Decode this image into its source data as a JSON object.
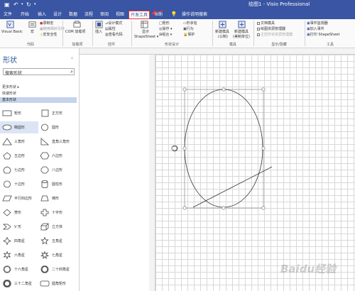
{
  "titlebar": {
    "doc_title": "绘图1 - Visio Professional"
  },
  "tabs": [
    "文件",
    "开始",
    "插入",
    "设计",
    "数据",
    "流程",
    "审阅",
    "视图",
    "开发工具",
    "帮助",
    "操作说明搜索"
  ],
  "ribbon": {
    "code": {
      "vb": "Visual Basic",
      "macro": "宏",
      "rec": "录制宏",
      "rel": "使用相对引用",
      "sec": "宏安全性",
      "label": "代码"
    },
    "addins": {
      "com": "COM 加载项",
      "label": "加载项"
    },
    "controls": {
      "insert": "插入",
      "design": "设计模式",
      "props": "属性",
      "code": "查看代码",
      "label": "控件"
    },
    "shape_design": {
      "show": "显示",
      "shapesheet": "ShapeSheet ▾",
      "rect": "矩形",
      "line": "线条",
      "oper": "操作 ▾",
      "combine": "组合 ▾",
      "name": "形状名",
      "behav": "行为",
      "prot": "保护",
      "label": "形状设计"
    },
    "template": {
      "new_stencil": "新建模具",
      "new_stencil_sub": "(公制)",
      "new_stencil2": "新建模具",
      "new_stencil2_sub": "(美制单位)",
      "label": "模具"
    },
    "show_hide": {
      "doc_stencil": "文档模具",
      "drawing_explorer": "绘图资源管理器",
      "master_explorer": "主控形状资源管理器",
      "label": "显示/隐藏"
    },
    "tools": {
      "event": "事件监视器",
      "addon": "加入事件",
      "print": "打印 ShapeSheet",
      "label": "工具"
    }
  },
  "sidebar": {
    "title": "形状",
    "search_placeholder": "搜索形状",
    "more": "更多形状",
    "quick": "快速形状",
    "basic": "基本形状",
    "shapes": [
      [
        "矩形",
        "正方形"
      ],
      [
        "椭圆形",
        "圆形"
      ],
      [
        "三角形",
        "直角三角形"
      ],
      [
        "五边形",
        "六边形"
      ],
      [
        "七边形",
        "八边形"
      ],
      [
        "十边形",
        "圆柱形"
      ],
      [
        "平行四边形",
        "梯形"
      ],
      [
        "菱形",
        "十字形"
      ],
      [
        "V 形",
        "立方体"
      ],
      [
        "四角星",
        "五角星"
      ],
      [
        "六角星",
        "七角星"
      ],
      [
        "十六角星",
        "二十四角星"
      ],
      [
        "三十二角星",
        "圆角矩形"
      ],
      [
        "剪去单角的矩形",
        "剪去同侧角的矩形"
      ]
    ]
  },
  "watermark": "Baidu经验"
}
